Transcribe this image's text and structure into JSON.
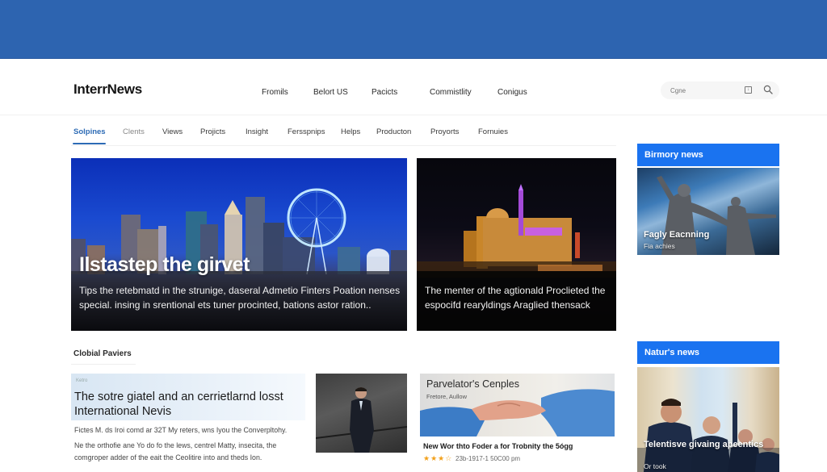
{
  "banner": {
    "color": "#2d64b0"
  },
  "header": {
    "logo": "InterrNews",
    "nav": [
      "Fromils",
      "Belort US",
      "Pacicts",
      "Commistlity",
      "Conigus"
    ],
    "search": {
      "placeholder": "Cgne",
      "icons": [
        "image-search-icon",
        "search-icon"
      ]
    }
  },
  "tabs": {
    "items": [
      "Solpines",
      "Clents",
      "Views",
      "Projicts",
      "Insight",
      "Fersspnips",
      "Helps",
      "Producton",
      "Proyorts",
      "Fornuies"
    ],
    "active_index": 0,
    "accent": "#2d6bb5"
  },
  "hero_main": {
    "title": "Ilstastep the girvet",
    "description": "Tips the retebmatd in the strunige, daseral Admetio Finters Poation nenses special. insing in srentional ets tuner procinted, bations astor ration..",
    "image": "city-skyline-ferris-wheel-night"
  },
  "hero_secondary": {
    "description": "The menter of the agtionald Proclieted the espocifd rearyldings Araglied thensack",
    "image": "illuminated-parliament-building-night"
  },
  "sidebar": {
    "accent": "#1a73f0",
    "sections": [
      {
        "heading": "Birmory news",
        "title": "Fagly Eacnning",
        "subtitle": "Fia achies",
        "image": "statues-against-sky"
      },
      {
        "heading": "Natur's news",
        "title": "Telentisve givaing apeentics",
        "subtitle": "Or took",
        "image": "businessmen-group"
      }
    ]
  },
  "global": {
    "label": "Clobial Paviers",
    "card1": {
      "kicker": "Ketro",
      "title": "The sotre giatel and an cerrietlarnd losst International Nevis",
      "meta": "Fictes M. ds Iroi comd ar 32T My reters, wns Iyou the Converpltohy.",
      "body": "Ne the orthofie ane Yo do fo the lews, centrel Matty, insecita, the comgroper adder of the eait the Ceolitire into and theds Ion."
    },
    "card2": {
      "image": "man-in-suit-walking"
    },
    "card3": {
      "title": "Parvelator's Cenples",
      "subtitle": "Fretore, Aullow",
      "headline": "New Wor thto Foder a for Trobnity the 5ógg",
      "rating": 3.5,
      "rating_max": 5,
      "stars": "★★★☆",
      "date": "23b-1917-1 50C00 pm",
      "image": "handshake-blue-sleeves"
    }
  }
}
